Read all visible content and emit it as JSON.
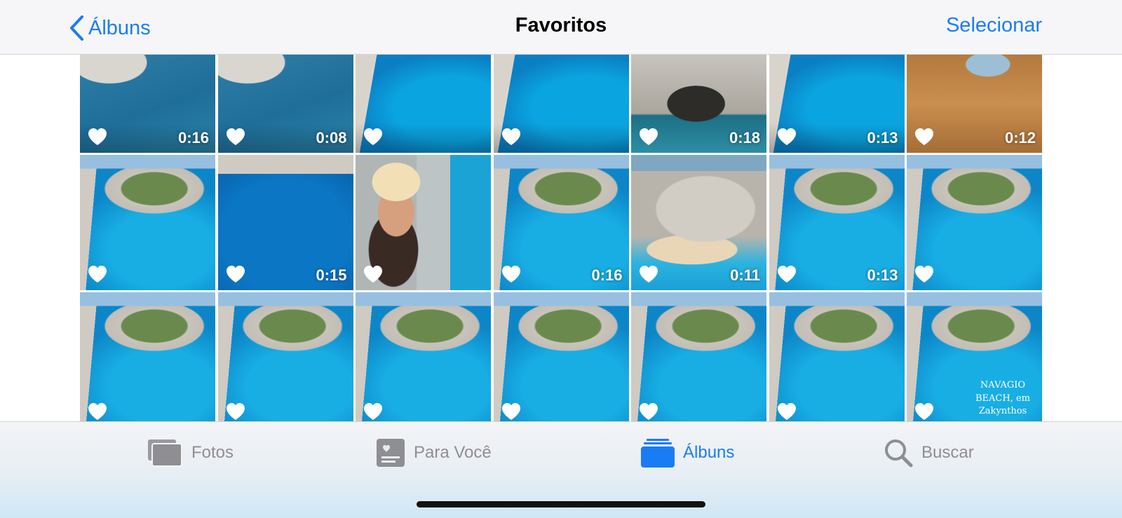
{
  "navbar": {
    "back_label": "Álbuns",
    "title": "Favoritos",
    "select_label": "Selecionar"
  },
  "grid": {
    "rows": [
      [
        {
          "duration": "0:16",
          "scene": "scene-a"
        },
        {
          "duration": "0:08",
          "scene": "scene-a"
        },
        {
          "duration": "",
          "scene": "scene-b"
        },
        {
          "duration": "",
          "scene": "scene-b"
        },
        {
          "duration": "0:18",
          "scene": "scene-cave"
        },
        {
          "duration": "0:13",
          "scene": "scene-b"
        },
        {
          "duration": "0:12",
          "scene": "scene-rock"
        }
      ],
      [
        {
          "duration": "",
          "scene": "scene-bay"
        },
        {
          "duration": "0:15",
          "scene": "scene-sea"
        },
        {
          "duration": "",
          "scene": "scene-selfie"
        },
        {
          "duration": "0:16",
          "scene": "scene-bay"
        },
        {
          "duration": "0:11",
          "scene": "scene-beach"
        },
        {
          "duration": "0:13",
          "scene": "scene-bay"
        },
        {
          "duration": "",
          "scene": "scene-bay"
        }
      ],
      [
        {
          "duration": "",
          "scene": "scene-bay"
        },
        {
          "duration": "",
          "scene": "scene-bay"
        },
        {
          "duration": "",
          "scene": "scene-bay"
        },
        {
          "duration": "",
          "scene": "scene-bay"
        },
        {
          "duration": "",
          "scene": "scene-bay"
        },
        {
          "duration": "",
          "scene": "scene-bay"
        },
        {
          "duration": "",
          "scene": "scene-bay",
          "overlay_text": "NAVAGIO BEACH, em Zakynthos"
        }
      ]
    ]
  },
  "tabbar": {
    "tabs": [
      {
        "label": "Fotos",
        "icon": "photos-icon",
        "active": false
      },
      {
        "label": "Para Você",
        "icon": "for-you-icon",
        "active": false
      },
      {
        "label": "Álbuns",
        "icon": "albums-icon",
        "active": true
      },
      {
        "label": "Buscar",
        "icon": "search-icon",
        "active": false
      }
    ]
  },
  "colors": {
    "accent": "#1a7cf5",
    "inactive": "#8e8e93"
  }
}
